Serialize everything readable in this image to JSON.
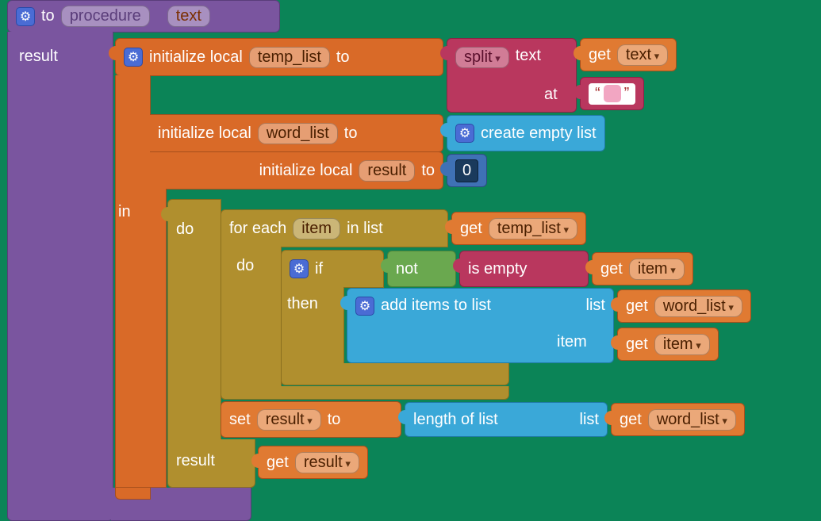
{
  "proc": {
    "to": "to",
    "name": "procedure",
    "param": "text",
    "result_label": "result"
  },
  "init1": {
    "label": "initialize local",
    "var": "temp_list",
    "to": "to"
  },
  "split": {
    "label_split": "split",
    "label_text": "text",
    "label_at": "at",
    "space_literal": " "
  },
  "get_text": {
    "get": "get",
    "var": "text"
  },
  "init2": {
    "label": "initialize local",
    "var": "word_list",
    "to": "to"
  },
  "create_empty": "create empty list",
  "init3": {
    "label": "initialize local",
    "var": "result",
    "to": "to",
    "value": "0"
  },
  "in": "in",
  "do": "do",
  "foreach": {
    "label_a": "for each",
    "var": "item",
    "label_b": "in list"
  },
  "get_temp": {
    "get": "get",
    "var": "temp_list"
  },
  "do2": "do",
  "if": "if",
  "not": "not",
  "is_empty": "is empty",
  "get_item": {
    "get": "get",
    "var": "item"
  },
  "then": "then",
  "additems": {
    "label": "add items to list",
    "list": "list",
    "item": "item"
  },
  "get_wordlist": {
    "get": "get",
    "var": "word_list"
  },
  "get_item2": {
    "get": "get",
    "var": "item"
  },
  "set": {
    "set": "set",
    "var": "result",
    "to": "to"
  },
  "length": {
    "label": "length of list",
    "list": "list"
  },
  "get_wordlist2": {
    "get": "get",
    "var": "word_list"
  },
  "result_kw": "result",
  "get_result": {
    "get": "get",
    "var": "result"
  }
}
